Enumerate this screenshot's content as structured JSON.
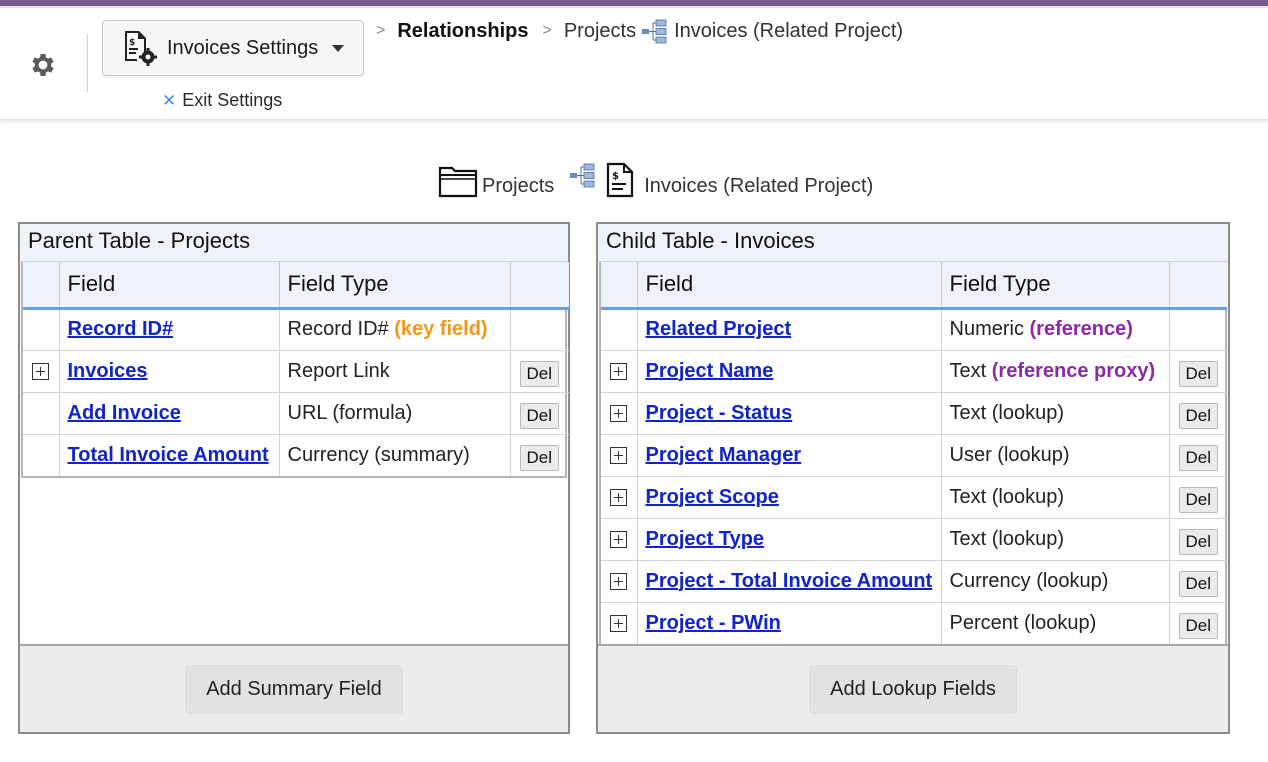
{
  "header": {
    "settings_label": "Invoices Settings",
    "exit_label": "Exit Settings",
    "breadcrumb": {
      "relationships": "Relationships",
      "projects": "Projects",
      "invoices": "Invoices (Related Project)"
    }
  },
  "relationship_title": {
    "parent": "Projects",
    "child": "Invoices (Related Project)"
  },
  "parent_table": {
    "title": "Parent Table - Projects",
    "col_field": "Field",
    "col_type": "Field Type",
    "rows": [
      {
        "field": "Record ID#",
        "type": "Record ID#",
        "tag": "(key field)",
        "del": ""
      },
      {
        "field": "Invoices",
        "type": "Report Link",
        "tag": "",
        "del": "Del"
      },
      {
        "field": "Add Invoice",
        "type": "URL (formula)",
        "tag": "",
        "del": "Del"
      },
      {
        "field": "Total Invoice Amount",
        "type": "Currency (summary)",
        "tag": "",
        "del": "Del"
      }
    ],
    "footer_button": "Add Summary Field"
  },
  "child_table": {
    "title": "Child Table - Invoices",
    "col_field": "Field",
    "col_type": "Field Type",
    "rows": [
      {
        "field": "Related Project",
        "type": "Numeric",
        "tag": "(reference)",
        "del": ""
      },
      {
        "field": "Project Name",
        "type": "Text",
        "tag": "(reference proxy)",
        "del": "Del"
      },
      {
        "field": "Project - Status",
        "type": "Text (lookup)",
        "tag": "",
        "del": "Del"
      },
      {
        "field": "Project Manager",
        "type": "User (lookup)",
        "tag": "",
        "del": "Del"
      },
      {
        "field": "Project Scope",
        "type": "Text (lookup)",
        "tag": "",
        "del": "Del"
      },
      {
        "field": "Project Type",
        "type": "Text (lookup)",
        "tag": "",
        "del": "Del"
      },
      {
        "field": "Project - Total Invoice Amount",
        "type": "Currency (lookup)",
        "tag": "",
        "del": "Del"
      },
      {
        "field": "Project - PWin",
        "type": "Percent (lookup)",
        "tag": "",
        "del": "Del"
      }
    ],
    "footer_button": "Add Lookup Fields"
  },
  "colors": {
    "accent_stripe": "#7b5a91",
    "link": "#1024c8",
    "key_field": "#f29a18",
    "reference": "#8a2aa8",
    "header_underline": "#6aa0dd"
  },
  "icons": [
    "gear-icon",
    "invoice-settings-icon",
    "close-icon",
    "chevron-right-icon",
    "relationship-icon",
    "folder-icon",
    "invoice-icon",
    "expand-icon"
  ]
}
